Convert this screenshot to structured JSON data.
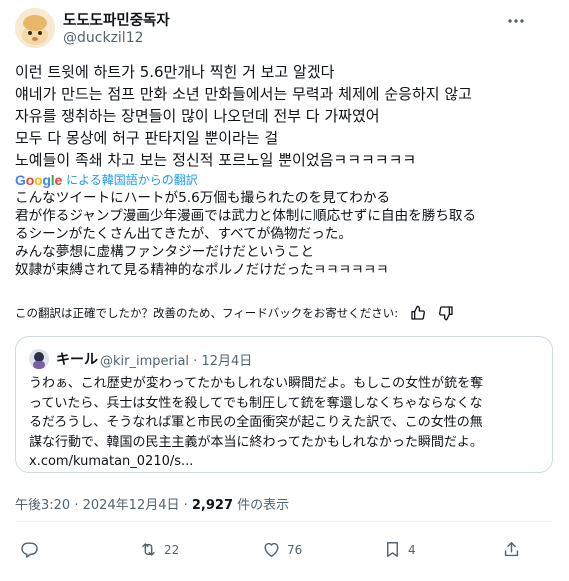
{
  "author": {
    "name": "도도도파민중독자",
    "handle": "@duckzil12"
  },
  "icons": {
    "more": "more-horizontal-icon",
    "reply": "reply-icon",
    "retweet": "retweet-icon",
    "like": "heart-icon",
    "bookmark": "bookmark-icon",
    "share": "share-icon",
    "thumbs_up": "thumbs-up-icon",
    "thumbs_down": "thumbs-down-icon"
  },
  "tweet_text": [
    "이런 트윗에 하트가 5.6만개나 찍힌 거 보고 알겠다",
    "얘네가 만드는 점프 만화 소년 만화들에서는 무력과 체제에 순응하지 않고",
    "자유를 쟁취하는 장면들이 많이 나오던데 전부 다 가짜였어",
    "모두 다 몽상에 허구 판타지일 뿐이라는 걸",
    "노예들이 족쇄 차고 보는 정신적 포르노일 뿐이었음ㅋㅋㅋㅋㅋㅋ"
  ],
  "translation": {
    "google_label": "Google",
    "label": "による韓国語からの翻訳",
    "lines": [
      "こんなツイートにハートが5.6万個も撮られたのを見てわかる",
      "君が作るジャンプ漫画少年漫画では武力と体制に順応せずに自由を勝ち取る",
      "るシーンがたくさん出てきたが、すべてが偽物だった。",
      "みんな夢想に虚構ファンタジーだけだということ",
      "奴隷が束縛されて見る精神的なポルノだけだったㅋㅋㅋㅋㅋㅋ"
    ],
    "feedback": "この翻訳は正確でしたか？改善のため、フィードバックをお寄せください:"
  },
  "quote": {
    "name": "キール",
    "meta": "@kir_imperial · 12月4日",
    "lines": [
      "うわぁ、これ歴史が変わってたかもしれない瞬間だよ。もしこの女性が銃を奪",
      "っていたら、兵士は女性を殺してでも制圧して銃を奪還しなくちゃならなくな",
      "るだろうし、そうなれば軍と市民の全面衝突が起こりえた訳で、この女性の無",
      "謀な行動で、韓国の民主主義が本当に終わってたかもしれなかった瞬間だよ。",
      "x.com/kumatan_0210/s..."
    ]
  },
  "timestamp": {
    "time": "午後3:20 · 2024年12月4日 · ",
    "views": "2,927",
    "views_suffix": " 件の表示"
  },
  "actions": {
    "reply_count": "",
    "retweet_count": "22",
    "like_count": "76",
    "bookmark_count": "4"
  },
  "colors": {
    "text": "#0f1419",
    "secondary": "#536471",
    "link": "#1d9bf0",
    "border": "#cfd9de"
  }
}
